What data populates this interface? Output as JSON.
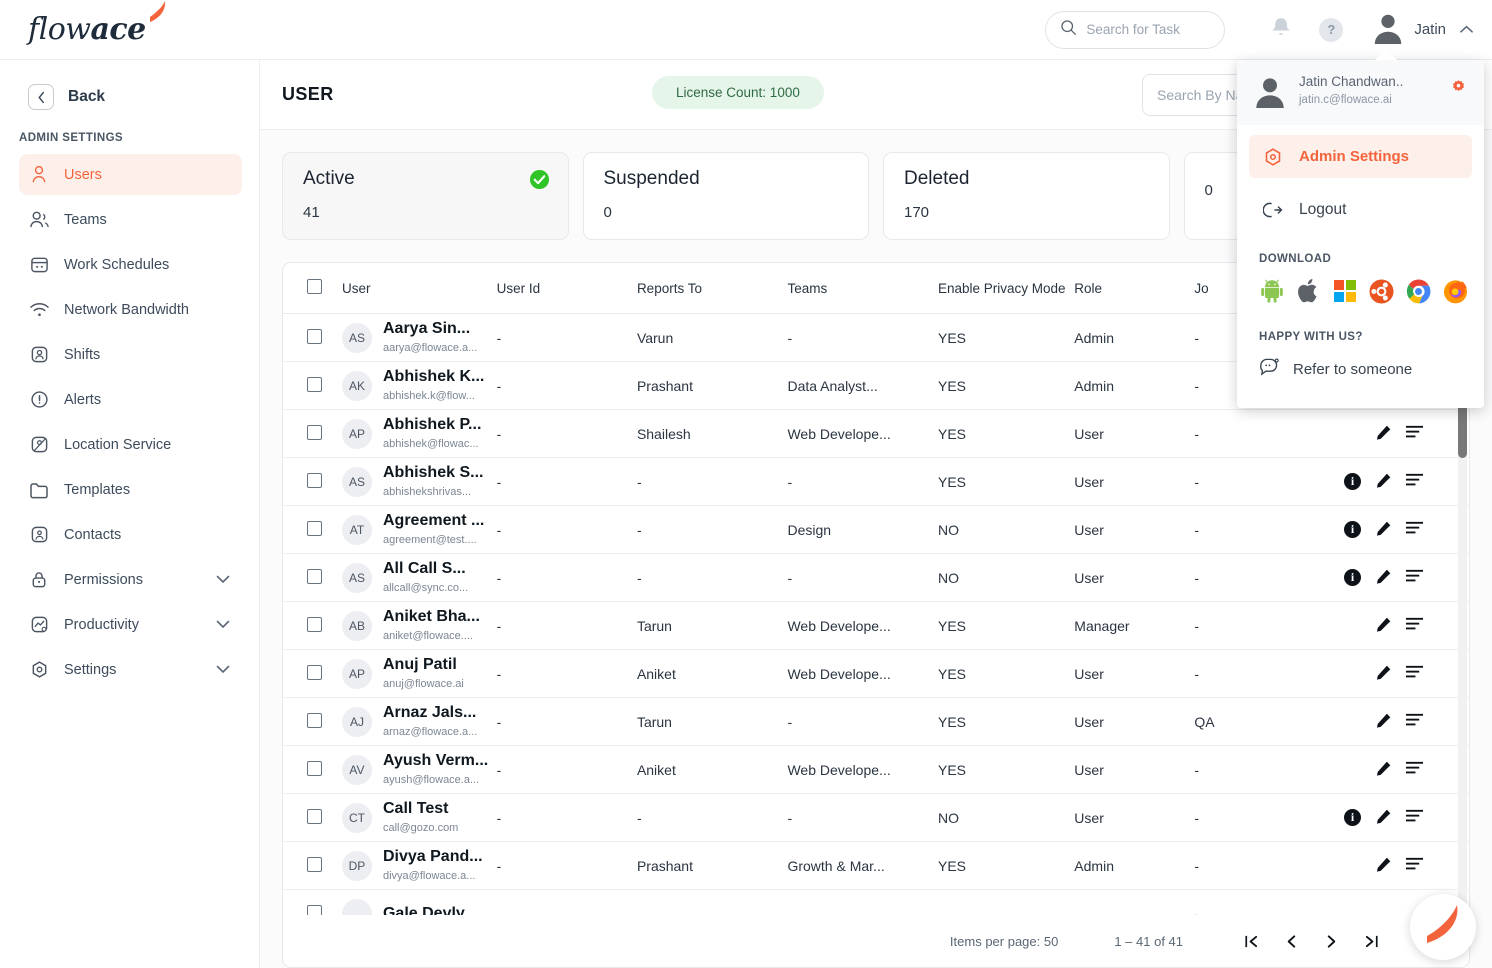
{
  "brand": {
    "logo_light": "flow",
    "logo_bold": "ace",
    "accent": "#f4643c"
  },
  "topbar": {
    "search_placeholder": "Search for Task",
    "search_value": "",
    "user_name": "Jatin",
    "bell_icon": "bell-icon",
    "help_icon": "help-icon",
    "caret_icon": "chevron-up-icon"
  },
  "sidebar": {
    "back_label": "Back",
    "section_label": "ADMIN SETTINGS",
    "items": [
      {
        "label": "Users",
        "icon": "user-icon",
        "active": true,
        "expandable": false
      },
      {
        "label": "Teams",
        "icon": "users-group-icon",
        "active": false,
        "expandable": false
      },
      {
        "label": "Work Schedules",
        "icon": "calendar-icon",
        "active": false,
        "expandable": false
      },
      {
        "label": "Network Bandwidth",
        "icon": "wifi-icon",
        "active": false,
        "expandable": false
      },
      {
        "label": "Shifts",
        "icon": "badge-person-icon",
        "active": false,
        "expandable": false
      },
      {
        "label": "Alerts",
        "icon": "alert-circle-icon",
        "active": false,
        "expandable": false
      },
      {
        "label": "Location Service",
        "icon": "location-pin-icon",
        "active": false,
        "expandable": false
      },
      {
        "label": "Templates",
        "icon": "folder-icon",
        "active": false,
        "expandable": false
      },
      {
        "label": "Contacts",
        "icon": "contact-card-icon",
        "active": false,
        "expandable": false
      },
      {
        "label": "Permissions",
        "icon": "lock-icon",
        "active": false,
        "expandable": true
      },
      {
        "label": "Productivity",
        "icon": "chart-icon",
        "active": false,
        "expandable": true
      },
      {
        "label": "Settings",
        "icon": "gear-hex-icon",
        "active": false,
        "expandable": true
      }
    ]
  },
  "main": {
    "page_title": "USER",
    "license_pill": "License Count: 1000",
    "search_placeholder": "Search By Name/Email",
    "search_value": "",
    "cards": [
      {
        "title": "Active",
        "value": "41",
        "selected": true,
        "badge": "check-circle-green-icon"
      },
      {
        "title": "Suspended",
        "value": "0",
        "selected": false,
        "badge": ""
      },
      {
        "title": "Deleted",
        "value": "170",
        "selected": false,
        "badge": ""
      },
      {
        "title": "",
        "value": "0",
        "selected": false,
        "badge": "globe-gray-icon"
      }
    ]
  },
  "table": {
    "headers": {
      "checkbox": "",
      "user": "User",
      "user_id": "User Id",
      "reports_to": "Reports To",
      "teams": "Teams",
      "privacy": "Enable Privacy Mode",
      "role": "Role",
      "job": "Jo",
      "actions": ""
    },
    "rows": [
      {
        "initials": "AS",
        "name": "Aarya Sin...",
        "email": "aarya@flowace.a...",
        "user_id": "-",
        "reports_to": "Varun",
        "teams": "-",
        "privacy": "YES",
        "role": "Admin",
        "job": "-",
        "has_info": false
      },
      {
        "initials": "AK",
        "name": "Abhishek K...",
        "email": "abhishek.k@flow...",
        "user_id": "-",
        "reports_to": "Prashant",
        "teams": "Data Analyst...",
        "privacy": "YES",
        "role": "Admin",
        "job": "-",
        "has_info": false
      },
      {
        "initials": "AP",
        "name": "Abhishek P...",
        "email": "abhishek@flowac...",
        "user_id": "-",
        "reports_to": "Shailesh",
        "teams": "Web Develope...",
        "privacy": "YES",
        "role": "User",
        "job": "-",
        "has_info": false
      },
      {
        "initials": "AS",
        "name": "Abhishek S...",
        "email": "abhishekshrivas...",
        "user_id": "-",
        "reports_to": "-",
        "teams": "-",
        "privacy": "YES",
        "role": "User",
        "job": "-",
        "has_info": true
      },
      {
        "initials": "AT",
        "name": "Agreement ...",
        "email": "agreement@test....",
        "user_id": "-",
        "reports_to": "-",
        "teams": "Design",
        "privacy": "NO",
        "role": "User",
        "job": "-",
        "has_info": true
      },
      {
        "initials": "AS",
        "name": "All Call S...",
        "email": "allcall@sync.co...",
        "user_id": "-",
        "reports_to": "-",
        "teams": "-",
        "privacy": "NO",
        "role": "User",
        "job": "-",
        "has_info": true
      },
      {
        "initials": "AB",
        "name": "Aniket Bha...",
        "email": "aniket@flowace....",
        "user_id": "-",
        "reports_to": "Tarun",
        "teams": "Web Develope...",
        "privacy": "YES",
        "role": "Manager",
        "job": "-",
        "has_info": false
      },
      {
        "initials": "AP",
        "name": "Anuj Patil",
        "email": "anuj@flowace.ai",
        "user_id": "-",
        "reports_to": "Aniket",
        "teams": "Web Develope...",
        "privacy": "YES",
        "role": "User",
        "job": "-",
        "has_info": false
      },
      {
        "initials": "AJ",
        "name": "Arnaz Jals...",
        "email": "arnaz@flowace.a...",
        "user_id": "-",
        "reports_to": "Tarun",
        "teams": "-",
        "privacy": "YES",
        "role": "User",
        "job": "QA",
        "has_info": false
      },
      {
        "initials": "AV",
        "name": "Ayush Verm...",
        "email": "ayush@flowace.a...",
        "user_id": "-",
        "reports_to": "Aniket",
        "teams": "Web Develope...",
        "privacy": "YES",
        "role": "User",
        "job": "-",
        "has_info": false
      },
      {
        "initials": "CT",
        "name": "Call Test",
        "email": "call@gozo.com",
        "user_id": "-",
        "reports_to": "-",
        "teams": "-",
        "privacy": "NO",
        "role": "User",
        "job": "-",
        "has_info": true
      },
      {
        "initials": "DP",
        "name": "Divya Pand...",
        "email": "divya@flowace.a...",
        "user_id": "-",
        "reports_to": "Prashant",
        "teams": "Growth & Mar...",
        "privacy": "YES",
        "role": "Admin",
        "job": "-",
        "has_info": false
      },
      {
        "initials": "GD",
        "name": "Gale Devly",
        "email": "",
        "user_id": "",
        "reports_to": "",
        "teams": "",
        "privacy": "",
        "role": "",
        "job": "-",
        "has_info": false
      }
    ]
  },
  "paginator": {
    "items_per_page": "Items per page: 50",
    "range": "1 – 41 of 41",
    "first_icon": "first-page-icon",
    "prev_icon": "previous-page-icon",
    "next_icon": "next-page-icon",
    "last_icon": "last-page-icon"
  },
  "dropdown": {
    "name": "Jatin Chandwan..",
    "email": "jatin.c@flowace.ai",
    "gear_icon": "gear-icon",
    "admin_settings": "Admin Settings",
    "logout": "Logout",
    "download_label": "DOWNLOAD",
    "download_icons": [
      "android-icon",
      "apple-icon",
      "windows-icon",
      "ubuntu-icon",
      "chrome-icon",
      "firefox-icon"
    ],
    "happy_label": "HAPPY WITH US?",
    "refer": "Refer to someone"
  },
  "fab": {
    "icon": "flowace-swoosh-icon"
  }
}
